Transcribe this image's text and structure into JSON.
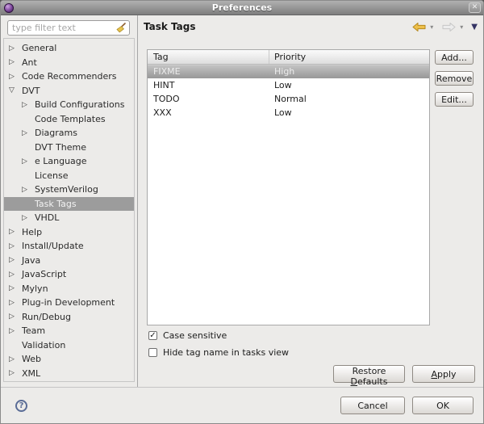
{
  "colors": {
    "titlebar_gray": "#8e8e8e",
    "selection_gray": "#9c9c9c",
    "back_arrow_gold": "#eec04a",
    "view_menu_navy": "#343464",
    "help_blue": "#5a6c96"
  },
  "icons": {
    "collapsed": "▷",
    "expanded": "▽",
    "none": "",
    "chevron_down": "▾",
    "view_menu": "▼",
    "check": "✓",
    "close": "✕",
    "help": "?"
  },
  "window": {
    "title": "Preferences"
  },
  "sidebar": {
    "filter_placeholder": "type filter text",
    "tree": [
      {
        "label": "General",
        "level": 0,
        "arrow": "collapsed",
        "selected": false
      },
      {
        "label": "Ant",
        "level": 0,
        "arrow": "collapsed",
        "selected": false
      },
      {
        "label": "Code Recommenders",
        "level": 0,
        "arrow": "collapsed",
        "selected": false
      },
      {
        "label": "DVT",
        "level": 0,
        "arrow": "expanded",
        "selected": false
      },
      {
        "label": "Build Configurations",
        "level": 1,
        "arrow": "collapsed",
        "selected": false
      },
      {
        "label": "Code Templates",
        "level": 1,
        "arrow": "none",
        "selected": false
      },
      {
        "label": "Diagrams",
        "level": 1,
        "arrow": "collapsed",
        "selected": false
      },
      {
        "label": "DVT Theme",
        "level": 1,
        "arrow": "none",
        "selected": false
      },
      {
        "label": "e Language",
        "level": 1,
        "arrow": "collapsed",
        "selected": false
      },
      {
        "label": "License",
        "level": 1,
        "arrow": "none",
        "selected": false
      },
      {
        "label": "SystemVerilog",
        "level": 1,
        "arrow": "collapsed",
        "selected": false
      },
      {
        "label": "Task Tags",
        "level": 1,
        "arrow": "none",
        "selected": true
      },
      {
        "label": "VHDL",
        "level": 1,
        "arrow": "collapsed",
        "selected": false
      },
      {
        "label": "Help",
        "level": 0,
        "arrow": "collapsed",
        "selected": false
      },
      {
        "label": "Install/Update",
        "level": 0,
        "arrow": "collapsed",
        "selected": false
      },
      {
        "label": "Java",
        "level": 0,
        "arrow": "collapsed",
        "selected": false
      },
      {
        "label": "JavaScript",
        "level": 0,
        "arrow": "collapsed",
        "selected": false
      },
      {
        "label": "Mylyn",
        "level": 0,
        "arrow": "collapsed",
        "selected": false
      },
      {
        "label": "Plug-in Development",
        "level": 0,
        "arrow": "collapsed",
        "selected": false
      },
      {
        "label": "Run/Debug",
        "level": 0,
        "arrow": "collapsed",
        "selected": false
      },
      {
        "label": "Team",
        "level": 0,
        "arrow": "collapsed",
        "selected": false
      },
      {
        "label": "Validation",
        "level": 0,
        "arrow": "none",
        "selected": false
      },
      {
        "label": "Web",
        "level": 0,
        "arrow": "collapsed",
        "selected": false
      },
      {
        "label": "XML",
        "level": 0,
        "arrow": "collapsed",
        "selected": false
      }
    ]
  },
  "content": {
    "title": "Task Tags",
    "table": {
      "columns": [
        "Tag",
        "Priority"
      ],
      "rows": [
        {
          "tag": "FIXME",
          "priority": "High",
          "selected": true
        },
        {
          "tag": "HINT",
          "priority": "Low",
          "selected": false
        },
        {
          "tag": "TODO",
          "priority": "Normal",
          "selected": false
        },
        {
          "tag": "XXX",
          "priority": "Low",
          "selected": false
        }
      ]
    },
    "side_buttons": {
      "add": "Add...",
      "remove": "Remove",
      "edit": "Edit..."
    },
    "checkboxes": [
      {
        "label": "Case sensitive",
        "checked": true
      },
      {
        "label": "Hide tag name in tasks view",
        "checked": false
      }
    ],
    "restore_defaults": {
      "before": "Restore ",
      "underlined": "D",
      "after": "efaults"
    },
    "apply": {
      "before": "",
      "underlined": "A",
      "after": "pply"
    }
  },
  "footer": {
    "cancel": "Cancel",
    "ok": "OK"
  }
}
